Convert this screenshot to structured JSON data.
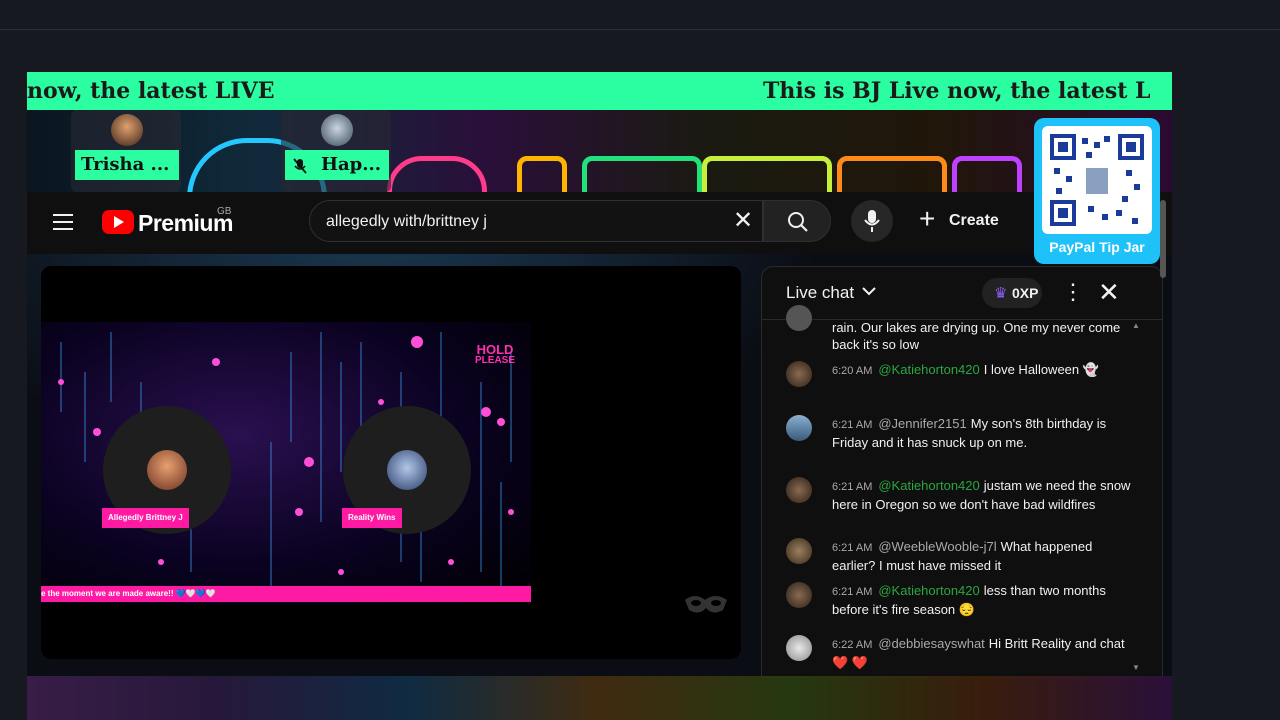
{
  "ticker": {
    "text_left": "now, the latest LIVE",
    "text_right": "This is BJ Live now, the latest L"
  },
  "guests": [
    {
      "label": "Trisha ..."
    },
    {
      "label": "Hap..."
    }
  ],
  "youtube": {
    "brand": "Premium",
    "region": "GB",
    "search_value": "allegedly with/brittney j",
    "create_label": "Create"
  },
  "tipjar": {
    "label": "PayPal Tip Jar"
  },
  "stream": {
    "host_tag": "Allegedly Brittney J",
    "guest_tag": "Reality Wins",
    "hold_line1": "HOLD",
    "hold_line2": "PLEASE",
    "marquee": "e the moment we are made aware!! 💙🤍💙🤍"
  },
  "chat": {
    "title": "Live chat",
    "xp": "0XP",
    "messages": [
      {
        "time": "",
        "author": "",
        "member": false,
        "text": "rain. Our lakes are drying up. One my never come back it's so low"
      },
      {
        "time": "6:20 AM",
        "author": "@Katiehorton420",
        "member": true,
        "text": "I love Halloween 👻"
      },
      {
        "time": "6:21 AM",
        "author": "@Jennifer2151",
        "member": false,
        "text": "My son's 8th birthday is Friday and it has snuck up on me."
      },
      {
        "time": "6:21 AM",
        "author": "@Katiehorton420",
        "member": true,
        "text": "justam we need the snow here in Oregon so we don't have bad wildfires"
      },
      {
        "time": "6:21 AM",
        "author": "@WeebleWooble-j7l",
        "member": false,
        "text": "What happened earlier? I must have missed it"
      },
      {
        "time": "6:21 AM",
        "author": "@Katiehorton420",
        "member": true,
        "text": "less than two months before it's fire season 😔"
      },
      {
        "time": "6:22 AM",
        "author": "@debbiesayswhat",
        "member": false,
        "text": "Hi Britt Reality and chat ❤️ ❤️"
      }
    ]
  },
  "colors": {
    "ticker_bg": "#2bfda1",
    "accent_pink": "#ff1aa3",
    "youtube_red": "#ff0000",
    "member_green": "#2ba640",
    "tipjar_blue": "#1fc2f8"
  },
  "icons": [
    "menu-icon",
    "youtube-play-icon",
    "search-icon",
    "close-icon",
    "microphone-icon",
    "plus-icon",
    "crown-icon",
    "more-vert-icon",
    "chevron-down-icon",
    "muted-mic-icon",
    "qr-code-icon"
  ]
}
